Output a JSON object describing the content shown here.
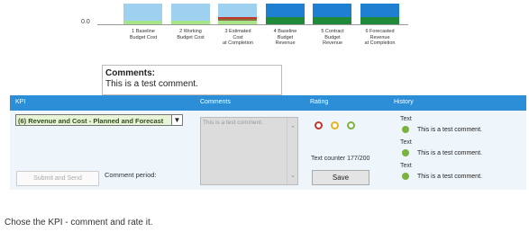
{
  "chart_data": {
    "type": "bar",
    "y_tick": "0.0",
    "categories": [
      "1 Baseline\nBudget Cost",
      "2 Working\nBudget Cost",
      "3 Estimated\nCost\nat Completion",
      "4 Baseline\nBudget\nRevenue",
      "5 Contract\nBudget\nRevenue",
      "6 Forecasted\nRevenue\nat Completion"
    ],
    "colors": {
      "cost_fill": "#9ed0ef",
      "revenue_fill": "#1f7fd0",
      "cost_base": "#a8e58a",
      "revenue_base": "#1e8a3a",
      "estimated_red": "#c0392b",
      "estimated_brown": "#8a6d3b"
    }
  },
  "comments_box": {
    "heading": "Comments:",
    "text": "This is a test comment."
  },
  "table_header": {
    "kpi": "KPI",
    "comments": "Comments",
    "rating": "Rating",
    "history": "History"
  },
  "kpi_select": {
    "value": "(6) Revenue and Cost - Planned and Forecast"
  },
  "comment_field": {
    "placeholder": "This is a test comment."
  },
  "rating": {
    "colors": [
      "#c0392b",
      "#e6b325",
      "#7ab33e"
    ],
    "selected_index": 0
  },
  "text_counter": "Text counter 177/200",
  "save_label": "Save",
  "submit_label": "Submit and Send",
  "comment_period_label": "Comment period:",
  "history": [
    {
      "label": "Text",
      "comment": "This is a test comment."
    },
    {
      "label": "Text",
      "comment": "This is a test comment."
    },
    {
      "label": "Text",
      "comment": "This is a test comment."
    }
  ],
  "caption": "Chose the KPI - comment and rate it."
}
